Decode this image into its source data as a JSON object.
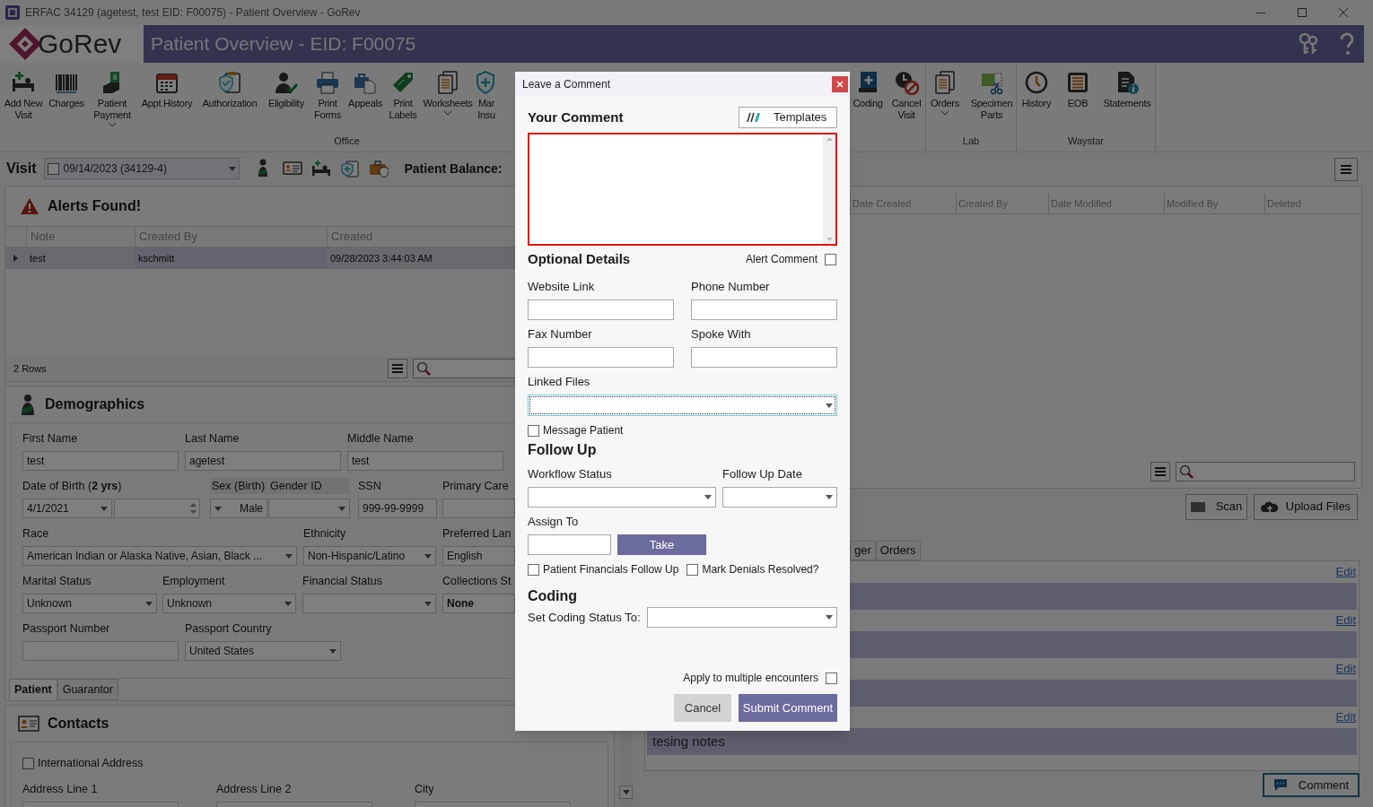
{
  "window": {
    "title": "ERFAC 34129 (agetest, test EID: F00075) - Patient Overview - GoRev"
  },
  "header": {
    "logo": "GoRev",
    "title": "Patient Overview - EID: F00075"
  },
  "toolbar": {
    "groups": [
      {
        "label": "Office",
        "items": [
          {
            "label": "Add New Visit",
            "dropdown": false
          },
          {
            "label": "Charges",
            "dropdown": false
          },
          {
            "label": "Patient Payment",
            "dropdown": true
          },
          {
            "label": "Appt History",
            "dropdown": false
          },
          {
            "label": "Authorization",
            "dropdown": false
          },
          {
            "label": "Eligibility",
            "dropdown": false
          },
          {
            "label": "Print Forms",
            "dropdown": false
          },
          {
            "label": "Appeals",
            "dropdown": false
          },
          {
            "label": "Print Labels",
            "dropdown": false
          },
          {
            "label": "Worksheets",
            "dropdown": true
          },
          {
            "label": "Mar Insu",
            "dropdown": false
          }
        ]
      },
      {
        "items": [
          {
            "label": "Coding",
            "dropdown": false
          },
          {
            "label": "Cancel Visit",
            "dropdown": false
          }
        ]
      },
      {
        "label": "Lab",
        "items": [
          {
            "label": "Orders",
            "dropdown": true
          },
          {
            "label": "Specimen Parts",
            "dropdown": false
          }
        ]
      },
      {
        "label": "Waystar",
        "items": [
          {
            "label": "History",
            "dropdown": false
          },
          {
            "label": "EOB",
            "dropdown": false
          },
          {
            "label": "Statements",
            "dropdown": false
          }
        ]
      }
    ]
  },
  "visit": {
    "label": "Visit",
    "selector": {
      "value": "09/14/2023 (34129-4)",
      "checked": false
    },
    "balance_label": "Patient Balance:"
  },
  "alerts": {
    "title": "Alerts Found!",
    "columns": [
      "Note",
      "Created By",
      "Created"
    ],
    "rows": [
      {
        "cells": [
          "test",
          "kschmitt",
          "09/28/2023 3:44:03 AM"
        ],
        "selected": true
      }
    ],
    "row_count": "2 Rows"
  },
  "demographics": {
    "title": "Demographics",
    "fields": [
      {
        "label": "First Name",
        "kind": "text",
        "value": "test"
      },
      {
        "label": "Last Name",
        "kind": "text",
        "value": "agetest"
      },
      {
        "label": "Middle Name",
        "kind": "text",
        "value": "test"
      },
      {
        "label": "Date of Birth (**2 yrs**)",
        "kind": "date_age",
        "value": "4/1/2021"
      },
      {
        "label": "Sex (Birth)",
        "kind": "sex",
        "value": "Male"
      },
      {
        "label": "Gender ID",
        "kind": "grid_dropdown"
      },
      {
        "label": "SSN",
        "kind": "text",
        "value": "999-99-9999"
      },
      {
        "label": "Primary Care",
        "kind": "text"
      },
      {
        "label": "Race",
        "kind": "dropdown",
        "value": "American Indian or Alaska Native, Asian, Black ..."
      },
      {
        "label": "Ethnicity",
        "kind": "dropdown",
        "value": "Non-Hispanic/Latino"
      },
      {
        "label": "Preferred Lan",
        "kind": "text",
        "value": "English"
      },
      {
        "label": "Marital Status",
        "kind": "dropdown",
        "value": "Unknown"
      },
      {
        "label": "Employment",
        "kind": "dropdown",
        "value": "Unknown"
      },
      {
        "label": "Financial Status",
        "kind": "dropdown"
      },
      {
        "label": "Collections St",
        "kind": "text",
        "value": "None",
        "bold": true
      },
      {
        "label": "Passport Number",
        "kind": "text"
      },
      {
        "label": "Passport Country",
        "kind": "dropdown",
        "value": "United States"
      }
    ],
    "tabs": [
      {
        "label": "Patient",
        "selected": true
      },
      {
        "label": "Guarantor",
        "selected": false
      }
    ]
  },
  "contacts": {
    "title": "Contacts",
    "international": {
      "label": "International Address",
      "checked": false
    },
    "labels": [
      "Address Line 1",
      "Address Line 2",
      "City"
    ]
  },
  "notes_panel": {
    "columns": [
      "Date Created",
      "Created By",
      "Date Modified",
      "Modified By",
      "Deleted"
    ],
    "buttons": [
      "Scan",
      "Upload Files"
    ],
    "tabs": [
      {
        "label": "ger",
        "selected": false
      },
      {
        "label": "Orders",
        "selected": false
      }
    ],
    "notes": [
      {
        "edit": "Edit"
      },
      {
        "edit": "Edit"
      },
      {
        "edit": "Edit"
      },
      {
        "edit": "Edit",
        "text": "tesing notes"
      }
    ],
    "comment_button": "Comment"
  },
  "dialog": {
    "title": "Leave a Comment",
    "comment": {
      "label": "Your Comment",
      "templates": "Templates",
      "invalid": true
    },
    "optional": {
      "title": "Optional Details",
      "alert": {
        "label": "Alert Comment",
        "checked": false
      },
      "fields": [
        {
          "label": "Website Link"
        },
        {
          "label": "Phone Number"
        },
        {
          "label": "Fax Number"
        },
        {
          "label": "Spoke With"
        }
      ],
      "linked_files": {
        "label": "Linked Files",
        "focused": true
      },
      "message_patient": {
        "label": "Message Patient",
        "checked": false
      }
    },
    "follow_up": {
      "title": "Follow Up",
      "workflow": {
        "label": "Workflow Status"
      },
      "date": {
        "label": "Follow Up Date"
      },
      "assign": {
        "label": "Assign To",
        "button": "Take"
      },
      "checks": [
        {
          "label": "Patient Financials Follow Up",
          "checked": false
        },
        {
          "label": "Mark Denials Resolved?",
          "checked": false
        }
      ]
    },
    "coding": {
      "title": "Coding",
      "label": "Set Coding Status To:"
    },
    "apply": {
      "label": "Apply to multiple encounters",
      "checked": false
    },
    "buttons": [
      {
        "label": "Cancel",
        "kind": "secondary"
      },
      {
        "label": "Submit Comment",
        "kind": "primary"
      }
    ]
  }
}
